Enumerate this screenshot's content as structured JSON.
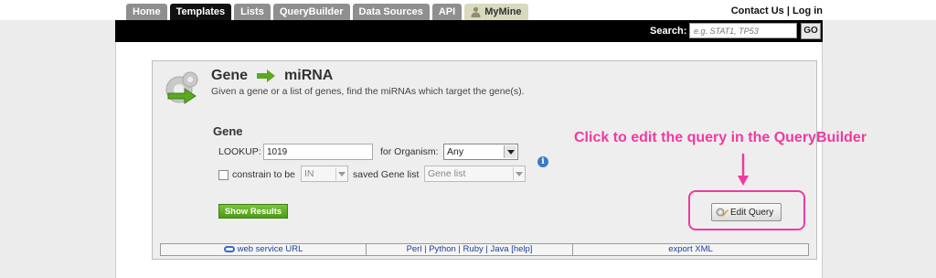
{
  "nav": {
    "tabs": [
      "Home",
      "Templates",
      "Lists",
      "QueryBuilder",
      "Data Sources",
      "API"
    ],
    "active_tab": "Templates",
    "mymine_label": "MyMine",
    "contact_us": "Contact Us",
    "separator": "|",
    "login": "Log in"
  },
  "search": {
    "label": "Search:",
    "placeholder": "e.g. STAT1, TP53",
    "go_label": "GO"
  },
  "template": {
    "from": "Gene",
    "to": "miRNA",
    "description": "Given a gene or a list of genes, find the miRNAs which target the gene(s).",
    "section_title": "Gene",
    "lookup_label": "LOOKUP:",
    "lookup_value": "1019",
    "organism_label": "for Organism:",
    "organism_value": "Any",
    "constrain_label": "constrain to be",
    "constrain_value": "IN",
    "saved_list_label": "saved Gene list",
    "saved_list_value": "Gene list",
    "show_results_label": "Show Results",
    "edit_query_label": "Edit Query"
  },
  "annotation": {
    "callout_text": "Click to edit the query in the QueryBuilder",
    "color": "#f03aa0"
  },
  "footer": {
    "web_service": "web service URL",
    "languages": [
      "Perl",
      "Python",
      "Ruby",
      "Java [help]"
    ],
    "export": "export XML"
  },
  "colors": {
    "accent_green": "#5aa91f",
    "black_bar": "#000000",
    "info_blue": "#3b79c7"
  }
}
